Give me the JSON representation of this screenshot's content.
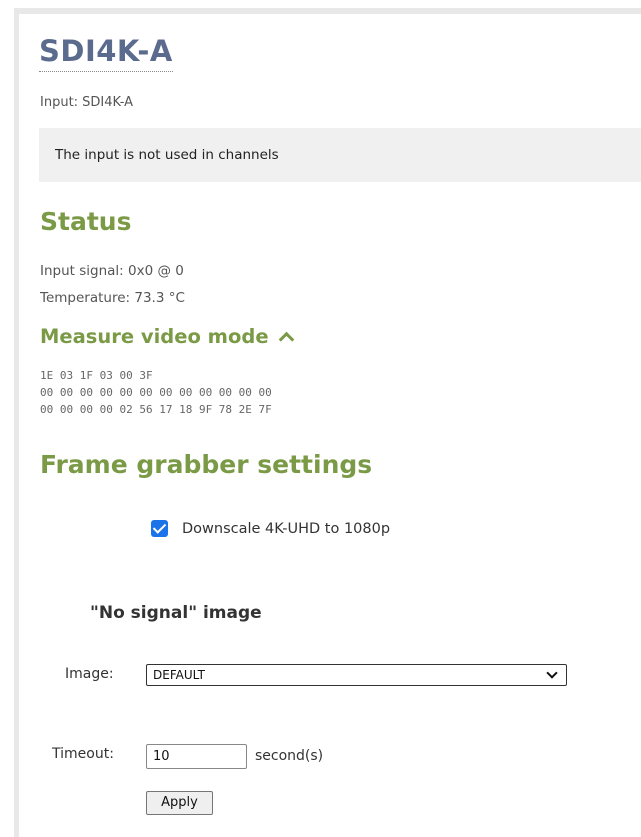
{
  "page": {
    "title": "SDI4K-A",
    "input_line": "Input: SDI4K-A",
    "notice": "The input is not used in channels"
  },
  "status": {
    "heading": "Status",
    "input_signal": "Input signal: 0x0 @ 0",
    "temperature": "Temperature: 73.3 °C"
  },
  "measure": {
    "heading": "Measure video mode",
    "expanded": true,
    "hex_lines": [
      "1E 03 1F 03 00 3F",
      "00 00 00 00 00 00 00 00 00 00 00 00",
      "00 00 00 00 02 56 17 18 9F 78 2E 7F"
    ]
  },
  "frame_grabber": {
    "heading": "Frame grabber settings",
    "downscale_label": "Downscale 4K-UHD to 1080p",
    "downscale_checked": true,
    "no_signal_heading": "\"No signal\" image",
    "image_label": "Image:",
    "image_value": "DEFAULT",
    "timeout_label": "Timeout:",
    "timeout_value": "10",
    "timeout_unit": "second(s)",
    "apply_label": "Apply"
  },
  "colors": {
    "title": "#5b6b8d",
    "section_heading": "#7a9a46",
    "checkbox": "#1a73e8",
    "notice_bg": "#f0f0f0"
  }
}
